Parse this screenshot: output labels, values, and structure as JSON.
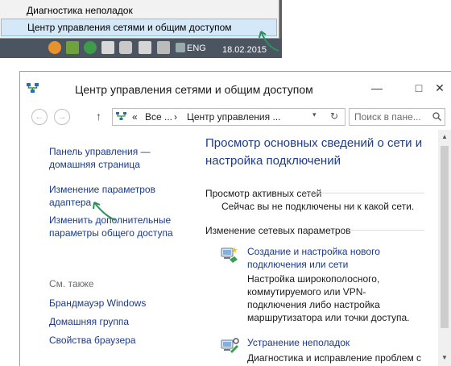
{
  "context_menu": {
    "items": [
      {
        "label": "Диагностика неполадок"
      },
      {
        "label": "Центр управления сетями и общим доступом"
      }
    ]
  },
  "taskbar": {
    "language": "ENG",
    "date": "18.02.2015"
  },
  "window": {
    "title": "Центр управления сетями и общим доступом",
    "controls": {
      "minimize": "—",
      "maximize": "□",
      "close": "✕"
    },
    "nav": {
      "back": "←",
      "forward": "→",
      "up": "↑",
      "breadcrumb": [
        "«",
        "Все ...",
        "›",
        "Центр управления ..."
      ],
      "dropdown": "▾",
      "refresh": "↻"
    },
    "search": {
      "placeholder": "Поиск в пане..."
    }
  },
  "left_pane": {
    "links": [
      "Панель управления — домашняя страница",
      "Изменение параметров адаптера",
      "Изменить дополнительные параметры общего доступа"
    ],
    "see_also_title": "См. также",
    "see_also": [
      "Брандмауэр Windows",
      "Домашняя группа",
      "Свойства браузера"
    ]
  },
  "main": {
    "title": "Просмотр основных сведений о сети и настройка подключений",
    "active_networks_header": "Просмотр активных сетей",
    "active_networks_text": "Сейчас вы не подключены ни к какой сети.",
    "change_settings_header": "Изменение сетевых параметров",
    "tasks": [
      {
        "link": "Создание и настройка нового подключения или сети",
        "desc": "Настройка широкополосного, коммутируемого или VPN-подключения либо настройка маршрутизатора или точки доступа."
      },
      {
        "link": "Устранение неполадок",
        "desc": "Диагностика и исправление проблем с"
      }
    ]
  },
  "colors": {
    "link": "#1a3a8a",
    "title_blue": "#1c3c8e",
    "menu_highlight": "#d5e8f7",
    "taskbar": "#4b5561",
    "arrow": "#2f8f5a"
  }
}
